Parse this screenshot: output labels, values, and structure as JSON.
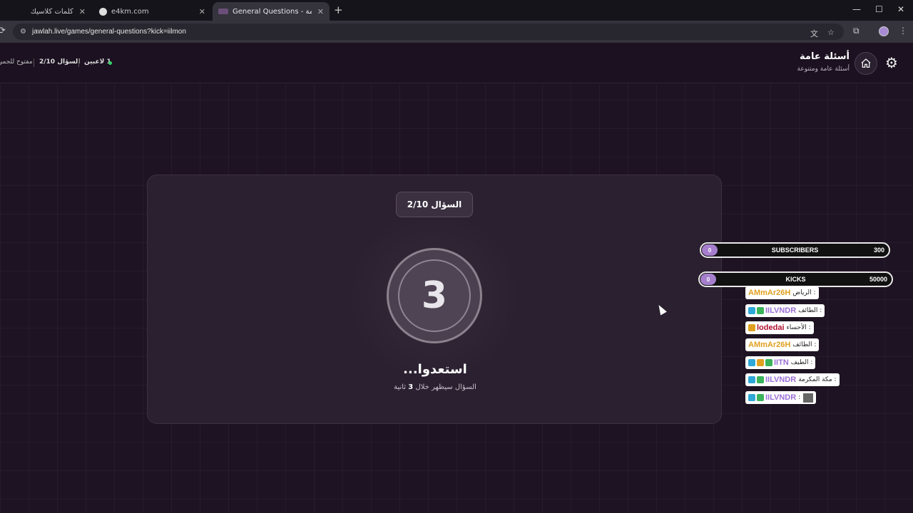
{
  "browser": {
    "tabs": [
      {
        "title": "كلمات كلاسيك",
        "close": "✕"
      },
      {
        "title": "e4km.com",
        "close": "✕"
      },
      {
        "title": "General Questions - أسئلة عامة",
        "close": "✕"
      }
    ],
    "new_tab": "+",
    "window_controls": [
      "—",
      "☐",
      "✕"
    ],
    "url": "jawlah.live/games/general-questions?kick=iilmon"
  },
  "header": {
    "title": "أسئلة عامة",
    "subtitle": "أسئلة عامة ومتنوعة",
    "status": {
      "players": "1 لاعبين",
      "question": "السؤال 2/10",
      "open": "مفتوح للجميع"
    }
  },
  "card": {
    "question_badge": "السؤال 2/10",
    "countdown": "3",
    "ready_text": "استعدوا...",
    "sub_text_before": "السؤال سيظهر خلال",
    "sub_text_number": "3",
    "sub_text_after": "ثانية"
  },
  "counters": [
    {
      "current": "0",
      "label": "SUBSCRIBERS",
      "goal": "300"
    },
    {
      "current": "0",
      "label": "KICKS",
      "goal": "50000"
    }
  ],
  "chat": [
    {
      "user": "AMmAr26H",
      "user_color": "#e0a020",
      "text": ": الرياض",
      "badges": []
    },
    {
      "user": "IILVNDR",
      "user_color": "#9b6fd6",
      "text": ": الطائف",
      "badges": [
        "#2fa8d8",
        "#3ab35a"
      ]
    },
    {
      "user": "lodedai",
      "user_color": "#b01030",
      "text": ": الأحساء",
      "badges": [
        "#e0a020"
      ]
    },
    {
      "user": "AMmAr26H",
      "user_color": "#e0a020",
      "text": ": الطائف",
      "badges": []
    },
    {
      "user": "IITN",
      "user_color": "#9b6fd6",
      "text": ": الطيف",
      "badges": [
        "#2fa8d8",
        "#e0a020",
        "#3ab35a"
      ]
    },
    {
      "user": "IILVNDR",
      "user_color": "#9b6fd6",
      "text": ": مكة المكرمة",
      "badges": [
        "#2fa8d8",
        "#3ab35a"
      ]
    },
    {
      "user": "IILVNDR",
      "user_color": "#9b6fd6",
      "text": ":",
      "badges": [
        "#2fa8d8",
        "#3ab35a"
      ]
    }
  ]
}
